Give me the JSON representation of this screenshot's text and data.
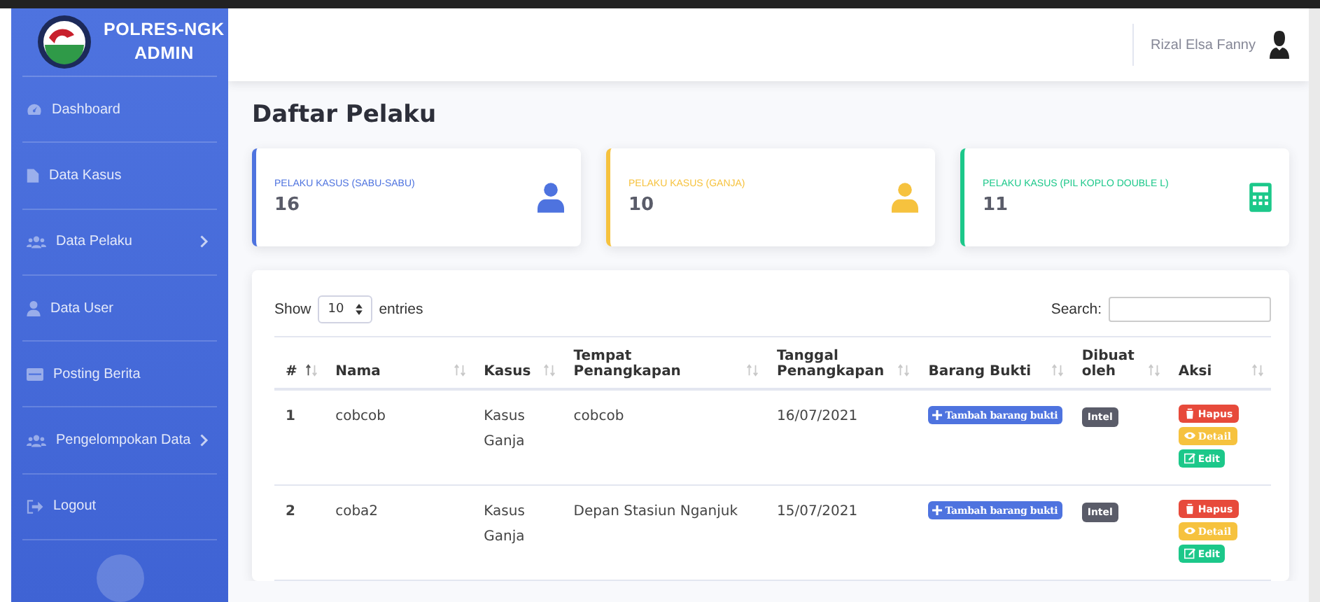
{
  "brand": {
    "line_1": "POLRES-NGK",
    "line_2": "ADMIN"
  },
  "sidebar": {
    "items": [
      {
        "label": "Dashboard",
        "kind": "gauge",
        "has_submenu": false
      },
      {
        "label": "Data Kasus",
        "kind": "file",
        "has_submenu": false
      },
      {
        "label": "Data Pelaku",
        "kind": "users",
        "has_submenu": true
      },
      {
        "label": "Data User",
        "kind": "user",
        "has_submenu": false
      },
      {
        "label": "Posting Berita",
        "kind": "card",
        "has_submenu": false
      },
      {
        "label": "Pengelompokan Data",
        "kind": "users",
        "has_submenu": true
      },
      {
        "label": "Logout",
        "kind": "logout",
        "has_submenu": false
      }
    ]
  },
  "topbar": {
    "user_name": "Rizal Elsa Fanny"
  },
  "page_title": "Daftar Pelaku",
  "stat_cards": [
    {
      "label": "PELAKU KASUS (SABU-SABU)",
      "value": "16",
      "color": "#4e73df",
      "kind": "user"
    },
    {
      "label": "PELAKU KASUS (GANJA)",
      "value": "10",
      "color": "#f6c23e",
      "kind": "user"
    },
    {
      "label": "PELAKU KASUS (PIL KOPLO DOUBLE L)",
      "value": "11",
      "color": "#1cc88a",
      "kind": "calculator"
    }
  ],
  "table": {
    "length_label_before": "Show",
    "length_value": "10",
    "length_label_after": "entries",
    "search_label": "Search:",
    "columns": [
      {
        "label": "#",
        "sorted": true
      },
      {
        "label": "Nama",
        "sorted": false
      },
      {
        "label": "Kasus",
        "sorted": false
      },
      {
        "label": "Tempat Penangkapan",
        "sorted": false
      },
      {
        "label": "Tanggal Penangkapan",
        "sorted": false
      },
      {
        "label": "Barang Bukti",
        "sorted": false
      },
      {
        "label": "Dibuat oleh",
        "sorted": false
      },
      {
        "label": "Aksi",
        "sorted": false
      }
    ],
    "rows": [
      {
        "no": "1",
        "nama": "cobcob",
        "kasus": "Kasus Ganja",
        "tempat": "cobcob",
        "tanggal": "16/07/2021",
        "bukti_button": "Tambah barang bukti",
        "dibuat_oleh": "Intel",
        "actions": [
          {
            "kind": "delete",
            "label": "Hapus"
          },
          {
            "kind": "detail",
            "label": "Detail"
          },
          {
            "kind": "edit",
            "label": "Edit"
          }
        ]
      },
      {
        "no": "2",
        "nama": "coba2",
        "kasus": "Kasus Ganja",
        "tempat": "Depan Stasiun Nganjuk",
        "tanggal": "15/07/2021",
        "bukti_button": "Tambah barang bukti",
        "dibuat_oleh": "Intel",
        "actions": [
          {
            "kind": "delete",
            "label": "Hapus"
          },
          {
            "kind": "detail",
            "label": "Detail"
          },
          {
            "kind": "edit",
            "label": "Edit"
          }
        ]
      }
    ]
  }
}
